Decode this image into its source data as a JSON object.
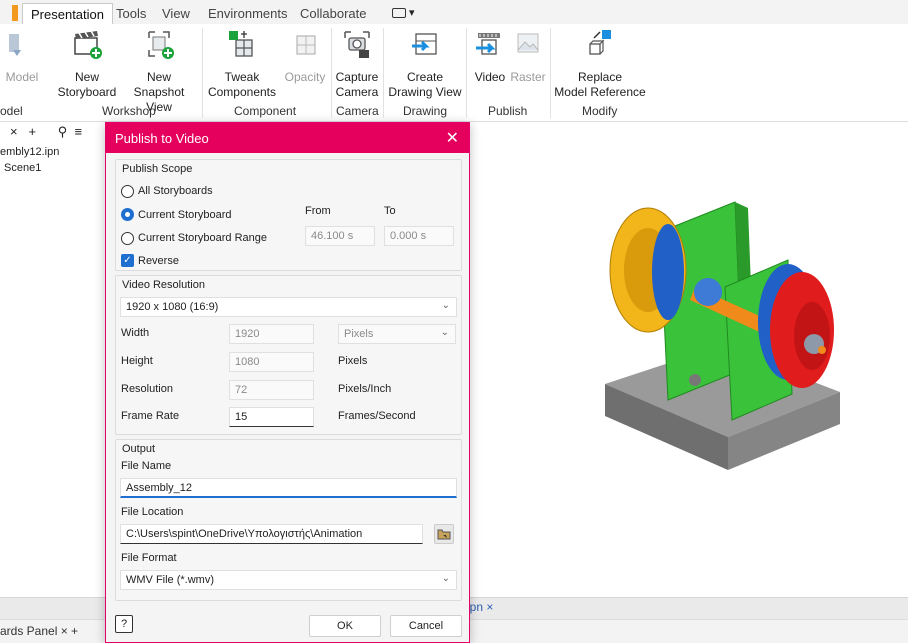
{
  "ribbon_tabs": [
    "Presentation",
    "Tools",
    "View",
    "Environments",
    "Collaborate"
  ],
  "ribbon": {
    "buttons": {
      "model": "Model",
      "new_storyboard": [
        "New",
        "Storyboard"
      ],
      "new_snapshot": [
        "New",
        "Snapshot View"
      ],
      "tweak": [
        "Tweak",
        "Components"
      ],
      "opacity": "Opacity",
      "capture": [
        "Capture",
        "Camera"
      ],
      "create_drawing": [
        "Create",
        "Drawing View"
      ],
      "video": "Video",
      "raster": "Raster",
      "replace": [
        "Replace",
        "Model Reference"
      ]
    },
    "groups": {
      "model": "odel",
      "workshop": "Workshop",
      "component": "Component",
      "camera": "Camera",
      "drawing": "Drawing",
      "publish": "Publish",
      "modify": "Modify"
    }
  },
  "browser": {
    "items": [
      "embly12.ipn",
      "Scene1"
    ]
  },
  "dialog": {
    "title": "Publish to Video",
    "publish_scope": {
      "label": "Publish Scope",
      "all": "All Storyboards",
      "current": "Current Storyboard",
      "range": "Current Storyboard Range",
      "from_label": "From",
      "to_label": "To",
      "from_value": "46.100 s",
      "to_value": "0.000 s",
      "reverse": "Reverse"
    },
    "video_resolution": {
      "label": "Video Resolution",
      "preset": "1920 x 1080 (16:9)",
      "width_label": "Width",
      "width_value": "1920",
      "units_value": "Pixels",
      "height_label": "Height",
      "height_value": "1080",
      "height_units": "Pixels",
      "resolution_label": "Resolution",
      "resolution_value": "72",
      "resolution_units": "Pixels/Inch",
      "framerate_label": "Frame Rate",
      "framerate_value": "15",
      "framerate_units": "Frames/Second"
    },
    "output": {
      "label": "Output",
      "filename_label": "File Name",
      "filename_value": "Assembly_12",
      "location_label": "File Location",
      "location_value": "C:\\Users\\spint\\OneDrive\\Υπολογιστής\\Animation",
      "format_label": "File Format",
      "format_value": "WMV File (*.wmv)"
    },
    "buttons": {
      "ok": "OK",
      "cancel": "Cancel"
    }
  },
  "doc_tab": "ipn ×",
  "panel_tab": "ards Panel ×  +",
  "colors": {
    "accent": "#e5005e",
    "selection": "#1f6fd1"
  }
}
